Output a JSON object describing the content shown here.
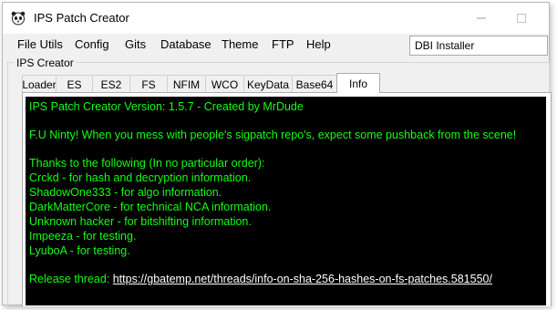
{
  "window": {
    "title": "IPS Patch Creator",
    "icon": "panda-app-icon",
    "controls": [
      "minimize-icon",
      "maximize-icon"
    ]
  },
  "menu": {
    "items": [
      "File Utils",
      "Config",
      "Gits",
      "Database",
      "Theme",
      "FTP",
      "Help"
    ],
    "dropdown_value": "DBI Installer"
  },
  "group": {
    "label": "IPS Creator"
  },
  "tabs": {
    "items": [
      "Loader",
      "ES",
      "ES2",
      "FS",
      "NFIM",
      "WCO",
      "KeyData",
      "Base64",
      "Info"
    ],
    "active": "Info"
  },
  "console": {
    "colors": {
      "background": "#000000",
      "text": "#13ff13",
      "link": "#ffffff"
    },
    "version_line": "IPS Patch Creator Version: 1.5.7 - Created by MrDude",
    "message_line": "F.U Ninty! When you mess with people's sigpatch repo's, expect some pushback from the scene!",
    "thanks_heading": "Thanks to the following (In no particular order):",
    "credits": [
      "Crckd - for hash and decryption information.",
      "ShadowOne333 - for algo information.",
      "DarkMatterCore - for technical NCA information.",
      "Unknown hacker - for bitshifting information.",
      "Impeeza - for testing.",
      "LyuboA - for testing."
    ],
    "release_label": "Release thread: ",
    "release_url": "https://gbatemp.net/threads/info-on-sha-256-hashes-on-fs-patches.581550/"
  }
}
